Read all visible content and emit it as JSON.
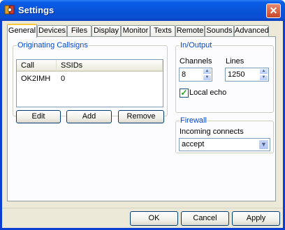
{
  "window": {
    "title": "Settings",
    "app_icon": "app-settings-icon",
    "close_icon": "close-icon"
  },
  "tabs": [
    {
      "label": "General",
      "active": true
    },
    {
      "label": "Devices"
    },
    {
      "label": "Files"
    },
    {
      "label": "Display"
    },
    {
      "label": "Monitor"
    },
    {
      "label": "Texts"
    },
    {
      "label": "Remote"
    },
    {
      "label": "Sounds"
    },
    {
      "label": "Advanced"
    }
  ],
  "originating": {
    "title": "Originating Callsigns",
    "columns": [
      "Call",
      "SSIDs"
    ],
    "rows": [
      {
        "call": "OK2IMH",
        "ssids": "0"
      }
    ],
    "buttons": {
      "edit": "Edit",
      "add": "Add",
      "remove": "Remove"
    }
  },
  "io": {
    "title": "In/Output",
    "channels_label": "Channels",
    "channels_value": "8",
    "lines_label": "Lines",
    "lines_value": "1250",
    "local_echo_label": "Local echo",
    "local_echo_checked": true
  },
  "firewall": {
    "title": "Firewall",
    "incoming_label": "Incoming connects",
    "incoming_value": "accept"
  },
  "footer": {
    "ok": "OK",
    "cancel": "Cancel",
    "apply": "Apply"
  }
}
